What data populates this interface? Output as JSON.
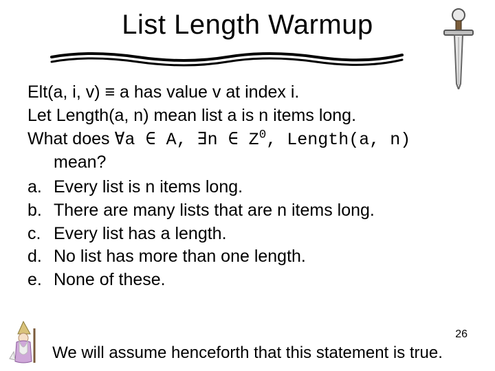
{
  "title": "List Length Warmup",
  "def_elt_prefix": "Elt(a, i, v) ",
  "def_elt_sym": "≡",
  "def_elt_suffix": " a has value v at index i.",
  "def_len": "Let Length(a, n) mean list a is n items long.",
  "q_prefix": "What does ",
  "q_code1": "∀a ∈ A, ∃n ∈ Z",
  "q_code_sup": "0",
  "q_code2": ", Length(a, n)",
  "q_mean": "mean?",
  "opts": {
    "a_lab": "a.",
    "a_txt": "Every list is n items long.",
    "b_lab": "b.",
    "b_txt": "There are many lists that are n items long.",
    "c_lab": "c.",
    "c_txt": "Every list has a length.",
    "d_lab": "d.",
    "d_txt": "No list has more than one length.",
    "e_lab": "e.",
    "e_txt": "None of these."
  },
  "footer": "We will assume henceforth that this statement is true.",
  "page": "26"
}
